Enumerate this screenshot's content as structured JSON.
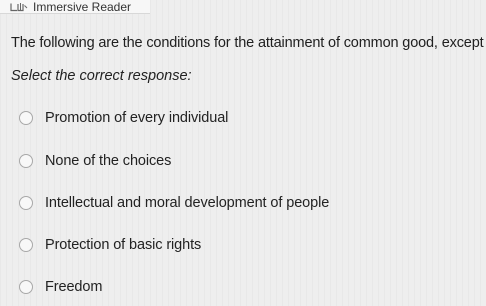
{
  "header": {
    "immersive_reader_label": "Immersive Reader",
    "immersive_reader_icon": "immersive-reader-icon"
  },
  "question": {
    "text": "The following are the conditions for the attainment of common good, except for:",
    "instruction": "Select the correct response:"
  },
  "options": [
    {
      "label": "Promotion of every individual",
      "selected": false
    },
    {
      "label": "None of the choices",
      "selected": false
    },
    {
      "label": "Intellectual and moral development of people",
      "selected": false
    },
    {
      "label": "Protection of basic rights",
      "selected": false
    },
    {
      "label": "Freedom",
      "selected": false
    }
  ],
  "colors": {
    "background": "#eeeeee",
    "text": "#222222",
    "radio_border": "#a8a8a8"
  }
}
